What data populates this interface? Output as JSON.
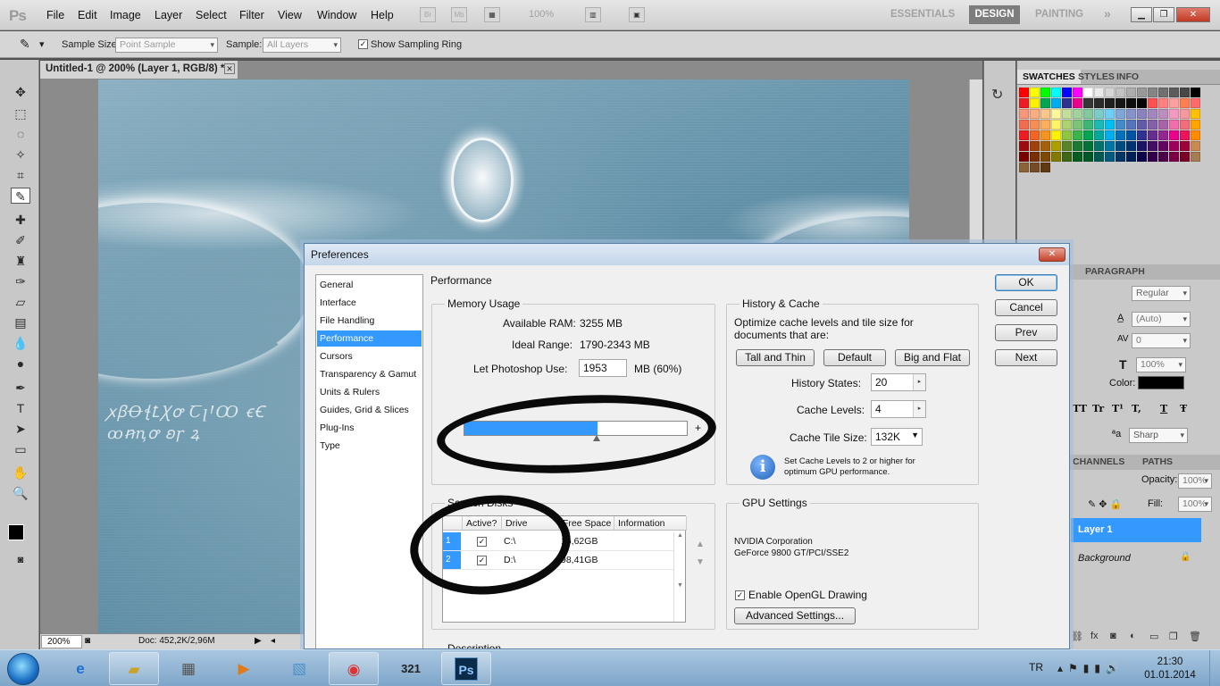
{
  "app": {
    "logo": "Ps"
  },
  "menu": [
    "File",
    "Edit",
    "Image",
    "Layer",
    "Select",
    "Filter",
    "View",
    "Window",
    "Help"
  ],
  "menubar_icons": {
    "bridge": "Br",
    "minibridge": "Mb",
    "zoom_value": "100%"
  },
  "workspaces": {
    "essentials": "ESSENTIALS",
    "design": "DESIGN",
    "painting": "PAINTING",
    "more": "»"
  },
  "window_controls": {
    "minimize": "▁",
    "restore": "❐",
    "close": "✕"
  },
  "options_bar": {
    "sample_size_label": "Sample Size:",
    "sample_size_value": "Point Sample",
    "sample_label": "Sample:",
    "sample_value": "All Layers",
    "show_sampling_ring_label": "Show Sampling Ring",
    "show_sampling_ring_checked": true
  },
  "document": {
    "tab_title": "Untitled-1 @ 200% (Layer 1, RGB/8) *",
    "zoom": "200%",
    "doc_info": "Doc: 452,2K/2,96M"
  },
  "panels": {
    "top_tabs": [
      "SWATCHES",
      "STYLES",
      "INFO"
    ],
    "char_tabs": [
      "PARAGRAPH"
    ],
    "char": {
      "style_value": "Regular",
      "leading_value": "(Auto)",
      "tracking_value": "0",
      "scale_value": "100%",
      "color_label": "Color:",
      "aa_label": "ªa",
      "aa_value": "Sharp",
      "type_buttons": [
        "TT",
        "Tr",
        "T¹",
        "T,",
        "T",
        "Ŧ"
      ]
    },
    "layers_tabs": [
      "CHANNELS",
      "PATHS"
    ],
    "layers": {
      "opacity_label": "Opacity:",
      "opacity_value": "100%",
      "fill_label": "Fill:",
      "fill_value": "100%",
      "items": [
        "Layer 1",
        "Background"
      ]
    },
    "swatch_colors": [
      "#ff0000",
      "#ffff00",
      "#00ff00",
      "#00ffff",
      "#0000ff",
      "#ff00ff",
      "#ffffff",
      "#ebebeb",
      "#d6d6d6",
      "#c2c2c2",
      "#adadad",
      "#999999",
      "#858585",
      "#707070",
      "#5c5c5c",
      "#474747",
      "#000000",
      "#ee1d24",
      "#fff100",
      "#00a650",
      "#00aeef",
      "#2f3192",
      "#ed008c",
      "#363636",
      "#2b2b2b",
      "#202020",
      "#161616",
      "#0d0d0d",
      "#050505",
      "#ff5050",
      "#ff8080",
      "#ffa0a0",
      "#ff7f50",
      "#ff6b6b",
      "#f7977a",
      "#f9ad81",
      "#fdc68a",
      "#fff79a",
      "#c4df9b",
      "#a2d39c",
      "#82ca9d",
      "#7bcdc8",
      "#6ecff6",
      "#7ea7d8",
      "#8493ca",
      "#8882be",
      "#a187be",
      "#bc8dbf",
      "#f49ac2",
      "#f6989d",
      "#ffc000",
      "#f26c4f",
      "#f68e55",
      "#fbaf5c",
      "#fff467",
      "#acd372",
      "#7cc576",
      "#3bb878",
      "#1abbb4",
      "#00bff3",
      "#438cca",
      "#5574b9",
      "#605ca8",
      "#855fa8",
      "#a763a8",
      "#f06ea9",
      "#f26d7d",
      "#ffa500",
      "#ed1c24",
      "#f26522",
      "#f7941d",
      "#fff200",
      "#8dc63f",
      "#39b54a",
      "#00a651",
      "#00a99d",
      "#00aeef",
      "#0072bc",
      "#0054a6",
      "#2e3192",
      "#662d91",
      "#92278f",
      "#ec008c",
      "#ed145b",
      "#ff8c00",
      "#9e0b0f",
      "#a0410d",
      "#a36209",
      "#aba000",
      "#598527",
      "#1a7b30",
      "#007236",
      "#00746b",
      "#0076a3",
      "#004b80",
      "#003471",
      "#1b1464",
      "#440e62",
      "#630460",
      "#9e005d",
      "#9e0039",
      "#c68c53",
      "#790000",
      "#7b2e00",
      "#7d4900",
      "#827b00",
      "#406618",
      "#005e20",
      "#005826",
      "#005952",
      "#005b7f",
      "#003663",
      "#002157",
      "#0d004c",
      "#32004b",
      "#4b0049",
      "#7b0046",
      "#7a0026",
      "#a67c52",
      "#8c6239",
      "#754c24",
      "#603913"
    ]
  },
  "dialog": {
    "title": "Preferences",
    "close": "✕",
    "nav": [
      "General",
      "Interface",
      "File Handling",
      "Performance",
      "Cursors",
      "Transparency & Gamut",
      "Units & Rulers",
      "Guides, Grid & Slices",
      "Plug-Ins",
      "Type"
    ],
    "active_nav": "Performance",
    "heading": "Performance",
    "memory": {
      "title": "Memory Usage",
      "available_label": "Available RAM:",
      "available_value": "3255 MB",
      "ideal_label": "Ideal Range:",
      "ideal_value": "1790-2343 MB",
      "use_label": "Let Photoshop Use:",
      "use_value": "1953",
      "use_suffix": "MB (60%)",
      "minus": "-",
      "plus": "+",
      "slider_percent": 60
    },
    "history_cache": {
      "title": "History & Cache",
      "description": "Optimize cache levels and tile size for documents that are:",
      "buttons": [
        "Tall and Thin",
        "Default",
        "Big and Flat"
      ],
      "history_states_label": "History States:",
      "history_states_value": "20",
      "cache_levels_label": "Cache Levels:",
      "cache_levels_value": "4",
      "tile_size_label": "Cache Tile Size:",
      "tile_size_value": "132K",
      "hint": "Set Cache Levels to 2 or higher for optimum GPU performance."
    },
    "scratch": {
      "title": "Scratch Disks",
      "columns": [
        "Active?",
        "Drive",
        "Free Space",
        "Information"
      ],
      "rows": [
        {
          "num": "1",
          "active": true,
          "drive": "C:\\",
          "free": "16,62GB",
          "info": ""
        },
        {
          "num": "2",
          "active": true,
          "drive": "D:\\",
          "free": "98,41GB",
          "info": ""
        }
      ]
    },
    "gpu": {
      "title": "GPU Settings",
      "vendor": "NVIDIA Corporation",
      "card": "GeForce 9800 GT/PCI/SSE2",
      "opengl_label": "Enable OpenGL Drawing",
      "opengl_checked": true,
      "advanced_label": "Advanced Settings..."
    },
    "description_title": "Description",
    "buttons": {
      "ok": "OK",
      "cancel": "Cancel",
      "prev": "Prev",
      "next": "Next"
    }
  },
  "taskbar": {
    "lang": "TR",
    "time": "21:30",
    "date": "01.01.2014",
    "ps_label": "Ps"
  }
}
